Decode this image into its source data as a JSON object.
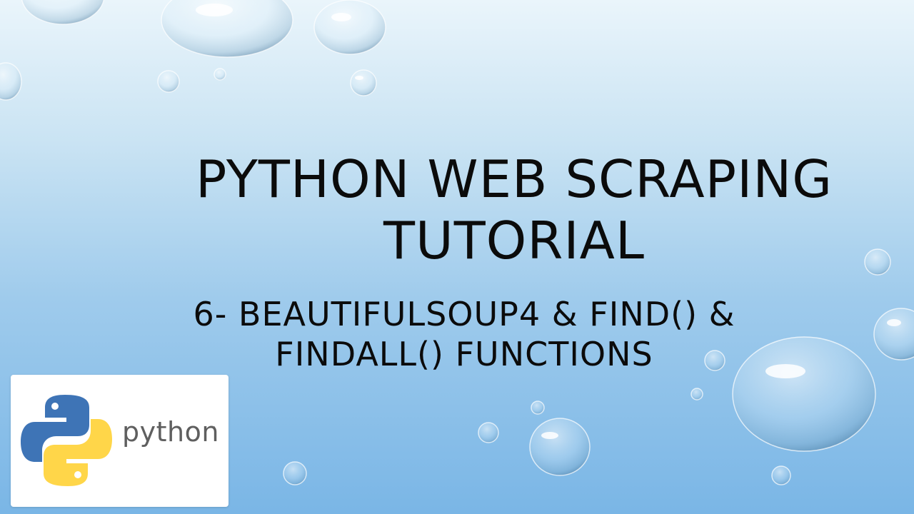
{
  "slide": {
    "title": "PYTHON WEB SCRAPING TUTORIAL",
    "subtitle": "6- BEAUTIFULSOUP4 & FIND() & FINDALL() FUNCTIONS"
  },
  "logo": {
    "wordmark": "python",
    "trademark": "™",
    "colors": {
      "blue": "#3e74b6",
      "yellow": "#ffd649",
      "text": "#5f5f5f"
    }
  },
  "background": {
    "colors": [
      "#eaf5fb",
      "#c9e3f3",
      "#9fcbec",
      "#7ab6e6"
    ],
    "decoration": "water droplets"
  }
}
